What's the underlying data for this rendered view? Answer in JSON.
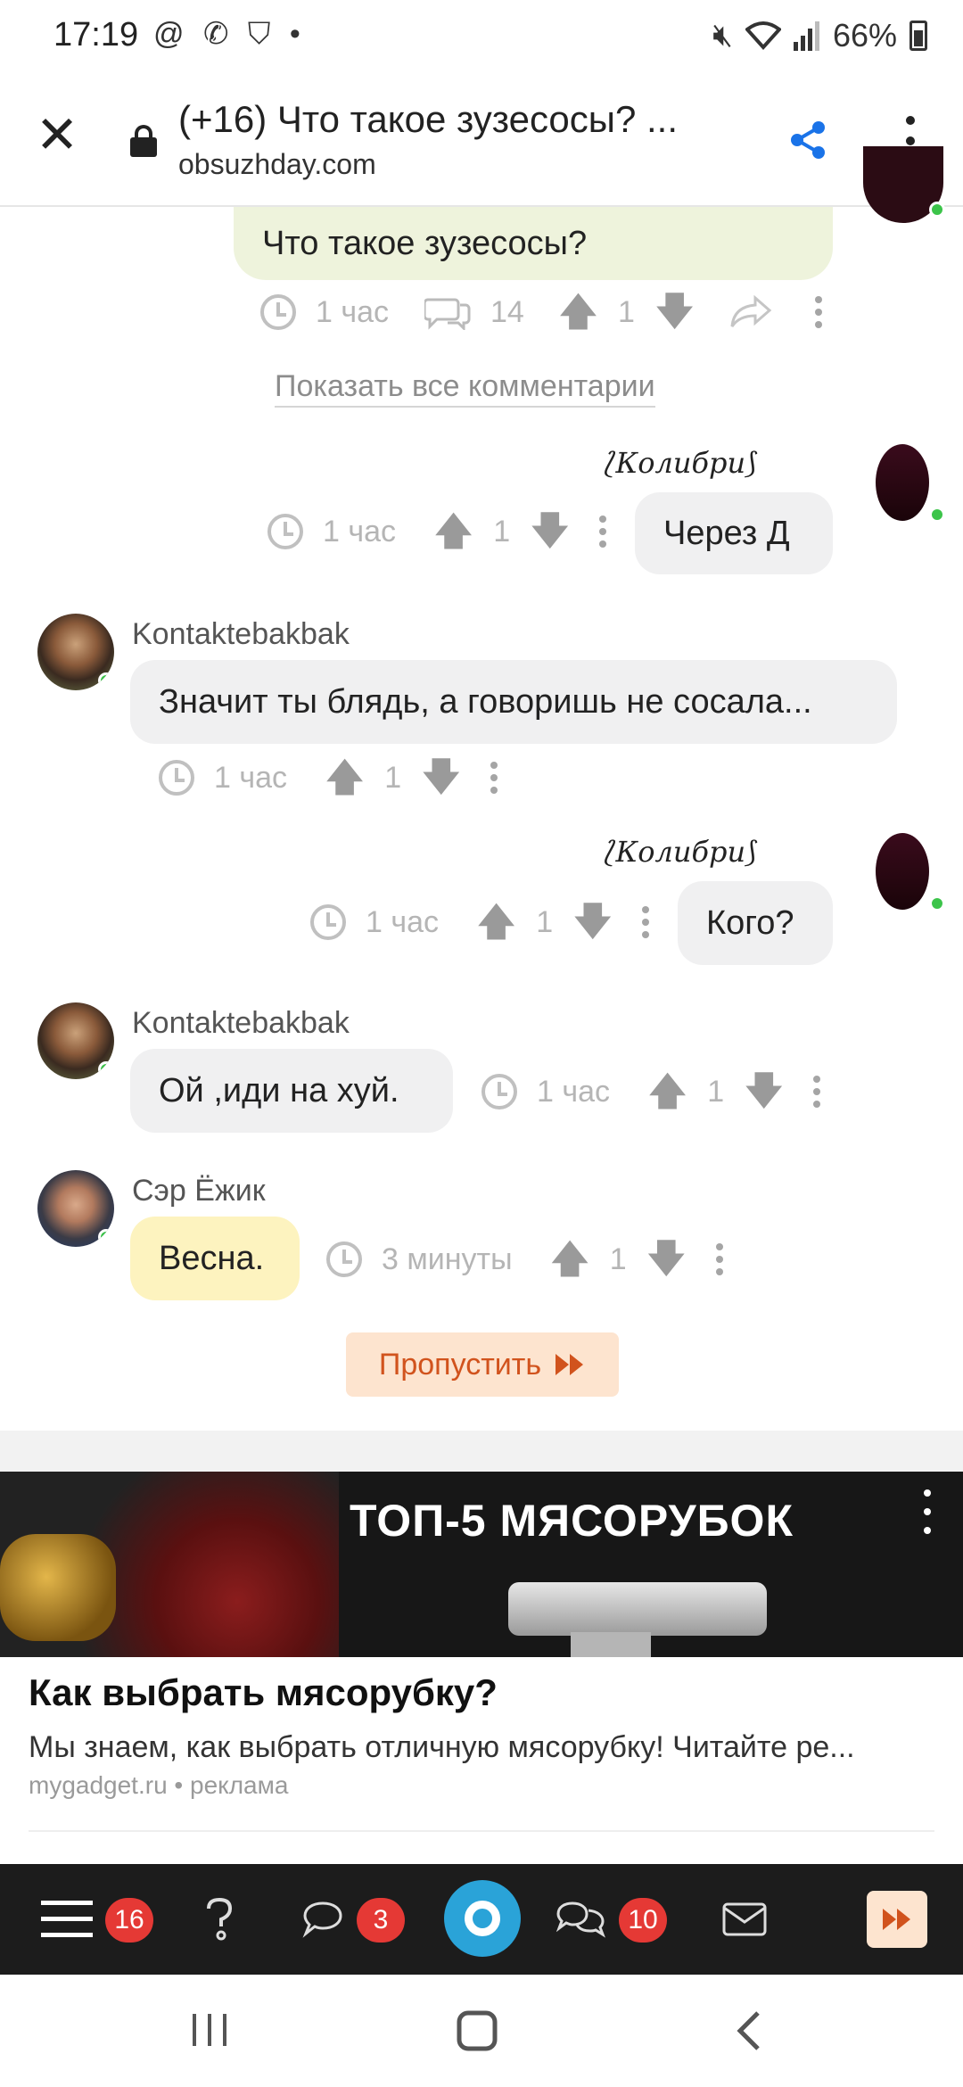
{
  "status_bar": {
    "time": "17:19",
    "left_icons": "@ ✆ ⛉ •",
    "battery": "66%"
  },
  "browser": {
    "title": "(+16) Что такое зузесосы? ...",
    "url": "obsuzhday.com"
  },
  "question": {
    "text": "Что такое зузесосы?",
    "time": "1 час",
    "comments_count": "14",
    "votes": "1"
  },
  "show_all_label": "Показать все комментарии",
  "comments": [
    {
      "author": "Колибри",
      "text": "Через Д",
      "time": "1 час",
      "votes": "1"
    },
    {
      "author": "Kontaktebakbak",
      "text": "Значит ты блядь, а говоришь не сосала...",
      "time": "1 час",
      "votes": "1"
    },
    {
      "author": "Колибри",
      "text": "Кого?",
      "time": "1 час",
      "votes": "1"
    },
    {
      "author": "Kontaktebakbak",
      "text": "Ой ,иди на хуй.",
      "time": "1 час",
      "votes": "1"
    },
    {
      "author": "Сэр Ёжик",
      "text": "Весна.",
      "time": "3 минуты",
      "votes": "1"
    }
  ],
  "skip_button": "Пропустить",
  "ad": {
    "banner_title": "ТОП-5 МЯСОРУБОК",
    "title": "Как выбрать мясорубку?",
    "description": "Мы знаем, как выбрать отличную мясорубку! Читайте ре...",
    "source": "mygadget.ru • реклама"
  },
  "bottom_nav": {
    "menu_badge": "16",
    "messages_badge": "3",
    "chats_badge": "10"
  },
  "colors": {
    "accent_blue": "#2aa3d8",
    "badge_red": "#e53935",
    "skip_orange": "#d1531d",
    "online_green": "#3cc44a"
  }
}
